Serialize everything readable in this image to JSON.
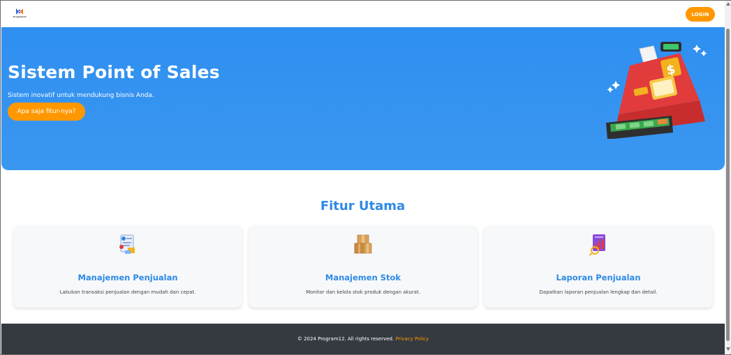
{
  "navbar": {
    "logo_text": "Program12",
    "login_label": "LOGIN"
  },
  "hero": {
    "title": "Sistem Point of Sales",
    "subtitle": "Sistem inovatif untuk mendukung bisnis Anda.",
    "cta_label": "Apa saja fitur-nya?",
    "illustration": "cash-register-icon"
  },
  "features": {
    "title": "Fitur Utama",
    "items": [
      {
        "icon": "sales-document-icon",
        "title": "Manajemen Penjualan",
        "desc": "Lakukan transaksi penjualan dengan mudah dan cepat."
      },
      {
        "icon": "boxes-icon",
        "title": "Manajemen Stok",
        "desc": "Monitor dan kelola stok produk dengan akurat."
      },
      {
        "icon": "report-chart-icon",
        "title": "Laporan Penjualan",
        "desc": "Dapatkan laporan penjualan lengkap dan detail."
      }
    ]
  },
  "footer": {
    "copyright": "© 2024 Program12. All rights reserved.",
    "privacy_label": "Privacy Policy"
  },
  "colors": {
    "primary": "#2d8ae6",
    "accent": "#ff9800",
    "footer_bg": "#343a40",
    "hero_bg": "#3490f0"
  }
}
